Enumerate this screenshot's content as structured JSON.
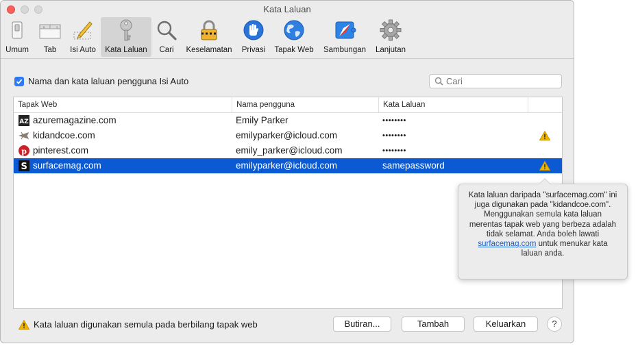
{
  "window": {
    "title": "Kata Laluan"
  },
  "toolbar": {
    "items": [
      {
        "label": "Umum",
        "icon": "switch-icon"
      },
      {
        "label": "Tab",
        "icon": "tabs-icon"
      },
      {
        "label": "Isi Auto",
        "icon": "pencil-icon"
      },
      {
        "label": "Kata Laluan",
        "icon": "key-icon",
        "selected": true
      },
      {
        "label": "Cari",
        "icon": "search-icon"
      },
      {
        "label": "Keselamatan",
        "icon": "lock-icon"
      },
      {
        "label": "Privasi",
        "icon": "hand-icon"
      },
      {
        "label": "Tapak Web",
        "icon": "globe-icon"
      },
      {
        "label": "Sambungan",
        "icon": "puzzle-icon"
      },
      {
        "label": "Lanjutan",
        "icon": "gear-icon"
      }
    ]
  },
  "autofill": {
    "label": "Nama dan kata laluan pengguna Isi Auto",
    "checked": true
  },
  "search": {
    "placeholder": "Cari"
  },
  "table": {
    "columns": [
      "Tapak Web",
      "Nama pengguna",
      "Kata Laluan"
    ],
    "rows": [
      {
        "site": "azuremagazine.com",
        "user": "Emily Parker",
        "password": "••••••••",
        "icon": "az-favicon",
        "warning": false,
        "selected": false
      },
      {
        "site": "kidandcoe.com",
        "user": "emilyparker@icloud.com",
        "password": "••••••••",
        "icon": "plane-favicon",
        "warning": true,
        "selected": false
      },
      {
        "site": "pinterest.com",
        "user": "emily_parker@icloud.com",
        "password": "••••••••",
        "icon": "pinterest-favicon",
        "warning": false,
        "selected": false
      },
      {
        "site": "surfacemag.com",
        "user": "emilyparker@icloud.com",
        "password": "samepassword",
        "icon": "s-favicon",
        "warning": true,
        "selected": true
      }
    ]
  },
  "popover": {
    "text_before": "Kata laluan daripada \"surfacemag.com\" ini juga digunakan pada \"kidandcoe.com\". Menggunakan semula kata laluan merentas tapak web yang berbeza adalah tidak selamat. Anda boleh lawati ",
    "link": "surfacemag.com",
    "text_after": " untuk menukar kata laluan anda."
  },
  "footer": {
    "warning": "Kata laluan digunakan semula pada berbilang tapak web",
    "details_button": "Butiran...",
    "add_button": "Tambah",
    "remove_button": "Keluarkan",
    "help_button": "?"
  },
  "colors": {
    "selection": "#0b5ad4",
    "close": "#fc605c",
    "warning": "#f0b400",
    "link": "#1a5fd0"
  }
}
